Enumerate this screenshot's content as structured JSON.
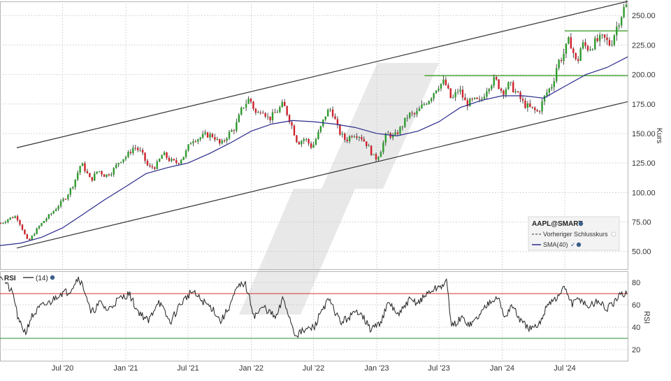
{
  "chart_data": [
    {
      "type": "candlestick",
      "panel": "price",
      "symbol": "AAPL@SMART",
      "ylabel": "Kurs",
      "ylim": [
        35,
        262
      ],
      "yticks": [
        50,
        75,
        100,
        125,
        150,
        175,
        200,
        225,
        250
      ],
      "ytick_labels": [
        "50.00",
        "75.00",
        "100.00",
        "125.00",
        "150.00",
        "175.00",
        "200.00",
        "225.00",
        "250.00"
      ],
      "xlim": [
        "2020-01-01",
        "2024-12-31"
      ],
      "xticks": [
        {
          "date": "2020-07-01",
          "label": "Jul '20"
        },
        {
          "date": "2021-01-01",
          "label": "Jan '21"
        },
        {
          "date": "2021-07-01",
          "label": "Jul '21"
        },
        {
          "date": "2022-01-01",
          "label": "Jan '22"
        },
        {
          "date": "2022-07-01",
          "label": "Jul '22"
        },
        {
          "date": "2023-01-01",
          "label": "Jan '23"
        },
        {
          "date": "2023-07-01",
          "label": "Jul '23"
        },
        {
          "date": "2024-01-01",
          "label": "Jan '24"
        },
        {
          "date": "2024-07-01",
          "label": "Jul '24"
        }
      ],
      "grid": true,
      "legend": {
        "title": "AAPL@SMART",
        "items": [
          {
            "label": "Vorheriger Schlusskurs",
            "style": "dashed",
            "color": "#333333"
          },
          {
            "label": "SMA(40)",
            "style": "solid",
            "color": "#2b2b8c"
          }
        ],
        "position": "bottom-right"
      },
      "close_series": [
        [
          "2020-01-06",
          74
        ],
        [
          "2020-01-27",
          78
        ],
        [
          "2020-02-17",
          80
        ],
        [
          "2020-03-02",
          72
        ],
        [
          "2020-03-16",
          62
        ],
        [
          "2020-03-23",
          58
        ],
        [
          "2020-04-06",
          64
        ],
        [
          "2020-04-20",
          70
        ],
        [
          "2020-05-11",
          77
        ],
        [
          "2020-06-01",
          83
        ],
        [
          "2020-06-22",
          90
        ],
        [
          "2020-07-13",
          97
        ],
        [
          "2020-08-03",
          108
        ],
        [
          "2020-08-24",
          125
        ],
        [
          "2020-09-07",
          118
        ],
        [
          "2020-09-21",
          110
        ],
        [
          "2020-10-12",
          119
        ],
        [
          "2020-11-02",
          114
        ],
        [
          "2020-11-23",
          118
        ],
        [
          "2020-12-14",
          127
        ],
        [
          "2021-01-04",
          131
        ],
        [
          "2021-01-25",
          139
        ],
        [
          "2021-02-15",
          134
        ],
        [
          "2021-03-08",
          121
        ],
        [
          "2021-03-29",
          122
        ],
        [
          "2021-04-19",
          133
        ],
        [
          "2021-05-10",
          127
        ],
        [
          "2021-05-31",
          125
        ],
        [
          "2021-06-21",
          132
        ],
        [
          "2021-07-12",
          145
        ],
        [
          "2021-08-02",
          146
        ],
        [
          "2021-08-23",
          149
        ],
        [
          "2021-09-13",
          148
        ],
        [
          "2021-10-04",
          140
        ],
        [
          "2021-10-25",
          149
        ],
        [
          "2021-11-15",
          155
        ],
        [
          "2021-12-06",
          172
        ],
        [
          "2021-12-27",
          180
        ],
        [
          "2022-01-17",
          165
        ],
        [
          "2022-01-31",
          172
        ],
        [
          "2022-02-21",
          162
        ],
        [
          "2022-03-14",
          168
        ],
        [
          "2022-04-04",
          175
        ],
        [
          "2022-04-25",
          160
        ],
        [
          "2022-05-16",
          142
        ],
        [
          "2022-06-06",
          146
        ],
        [
          "2022-06-27",
          138
        ],
        [
          "2022-07-18",
          152
        ],
        [
          "2022-08-08",
          168
        ],
        [
          "2022-08-22",
          171
        ],
        [
          "2022-09-12",
          152
        ],
        [
          "2022-10-03",
          144
        ],
        [
          "2022-10-24",
          150
        ],
        [
          "2022-11-14",
          148
        ],
        [
          "2022-12-05",
          140
        ],
        [
          "2022-12-27",
          128
        ],
        [
          "2023-01-09",
          133
        ],
        [
          "2023-01-30",
          150
        ],
        [
          "2023-02-20",
          147
        ],
        [
          "2023-03-13",
          155
        ],
        [
          "2023-04-03",
          166
        ],
        [
          "2023-04-24",
          166
        ],
        [
          "2023-05-15",
          174
        ],
        [
          "2023-06-05",
          180
        ],
        [
          "2023-06-26",
          190
        ],
        [
          "2023-07-17",
          194
        ],
        [
          "2023-08-07",
          178
        ],
        [
          "2023-08-28",
          188
        ],
        [
          "2023-09-18",
          175
        ],
        [
          "2023-10-09",
          178
        ],
        [
          "2023-10-30",
          177
        ],
        [
          "2023-11-20",
          190
        ],
        [
          "2023-12-11",
          196
        ],
        [
          "2024-01-02",
          185
        ],
        [
          "2024-01-22",
          192
        ],
        [
          "2024-02-12",
          184
        ],
        [
          "2024-03-04",
          175
        ],
        [
          "2024-03-25",
          171
        ],
        [
          "2024-04-15",
          168
        ],
        [
          "2024-05-06",
          183
        ],
        [
          "2024-05-27",
          192
        ],
        [
          "2024-06-10",
          210
        ],
        [
          "2024-06-24",
          215
        ],
        [
          "2024-07-15",
          230
        ],
        [
          "2024-08-05",
          208
        ],
        [
          "2024-08-19",
          226
        ],
        [
          "2024-09-09",
          222
        ],
        [
          "2024-09-30",
          228
        ],
        [
          "2024-10-21",
          231
        ],
        [
          "2024-11-11",
          225
        ],
        [
          "2024-12-02",
          243
        ],
        [
          "2024-12-23",
          258
        ]
      ],
      "sma40": [
        [
          "2020-01-01",
          55
        ],
        [
          "2020-03-01",
          57
        ],
        [
          "2020-05-01",
          62
        ],
        [
          "2020-07-01",
          70
        ],
        [
          "2020-09-01",
          82
        ],
        [
          "2020-11-01",
          94
        ],
        [
          "2021-01-01",
          105
        ],
        [
          "2021-03-01",
          116
        ],
        [
          "2021-05-01",
          121
        ],
        [
          "2021-07-01",
          125
        ],
        [
          "2021-09-01",
          133
        ],
        [
          "2021-11-01",
          142
        ],
        [
          "2022-01-01",
          152
        ],
        [
          "2022-03-01",
          158
        ],
        [
          "2022-05-01",
          161
        ],
        [
          "2022-07-01",
          160
        ],
        [
          "2022-09-01",
          158
        ],
        [
          "2022-11-01",
          155
        ],
        [
          "2023-01-01",
          150
        ],
        [
          "2023-03-01",
          148
        ],
        [
          "2023-05-01",
          152
        ],
        [
          "2023-07-01",
          160
        ],
        [
          "2023-09-01",
          172
        ],
        [
          "2023-11-01",
          178
        ],
        [
          "2024-01-01",
          182
        ],
        [
          "2024-03-01",
          182
        ],
        [
          "2024-05-01",
          180
        ],
        [
          "2024-07-01",
          190
        ],
        [
          "2024-09-01",
          200
        ],
        [
          "2024-11-01",
          206
        ],
        [
          "2024-12-31",
          215
        ]
      ],
      "trend_channel": {
        "upper": [
          [
            "2020-01-01",
            135
          ],
          [
            "2024-12-31",
            262
          ]
        ],
        "lower": [
          [
            "2020-01-01",
            50
          ],
          [
            "2024-12-31",
            177
          ]
        ]
      },
      "horizontal_levels": [
        {
          "value": 199,
          "from": "2023-05-20",
          "to": "2024-12-31",
          "color": "#3fa02a"
        },
        {
          "value": 237,
          "from": "2024-07-01",
          "to": "2024-12-31",
          "color": "#3fa02a"
        }
      ]
    },
    {
      "type": "line",
      "panel": "indicator",
      "title": "RSI",
      "ylabel": "RSI",
      "series": [
        {
          "name": "(14)",
          "color": "#222222"
        }
      ],
      "ylim": [
        10,
        90
      ],
      "yticks": [
        20,
        40,
        60,
        80
      ],
      "ytick_labels": [
        "20",
        "40",
        "60",
        "80"
      ],
      "overbought": 70,
      "oversold": 30,
      "points": [
        [
          "2020-01-01",
          88
        ],
        [
          "2020-02-10",
          68
        ],
        [
          "2020-02-24",
          45
        ],
        [
          "2020-03-16",
          35
        ],
        [
          "2020-03-30",
          48
        ],
        [
          "2020-04-27",
          58
        ],
        [
          "2020-05-25",
          62
        ],
        [
          "2020-06-22",
          70
        ],
        [
          "2020-07-20",
          72
        ],
        [
          "2020-08-17",
          85
        ],
        [
          "2020-09-07",
          70
        ],
        [
          "2020-09-21",
          52
        ],
        [
          "2020-10-19",
          62
        ],
        [
          "2020-11-09",
          55
        ],
        [
          "2020-12-07",
          64
        ],
        [
          "2021-01-11",
          70
        ],
        [
          "2021-02-01",
          56
        ],
        [
          "2021-03-08",
          45
        ],
        [
          "2021-04-05",
          64
        ],
        [
          "2021-05-10",
          44
        ],
        [
          "2021-06-07",
          60
        ],
        [
          "2021-07-12",
          72
        ],
        [
          "2021-08-09",
          64
        ],
        [
          "2021-09-13",
          56
        ],
        [
          "2021-10-04",
          45
        ],
        [
          "2021-10-25",
          56
        ],
        [
          "2021-11-22",
          75
        ],
        [
          "2021-12-13",
          80
        ],
        [
          "2022-01-10",
          50
        ],
        [
          "2022-02-07",
          58
        ],
        [
          "2022-03-14",
          48
        ],
        [
          "2022-04-04",
          66
        ],
        [
          "2022-05-09",
          33
        ],
        [
          "2022-06-13",
          38
        ],
        [
          "2022-07-04",
          40
        ],
        [
          "2022-07-25",
          56
        ],
        [
          "2022-08-15",
          64
        ],
        [
          "2022-09-19",
          44
        ],
        [
          "2022-10-17",
          50
        ],
        [
          "2022-11-14",
          55
        ],
        [
          "2022-12-12",
          38
        ],
        [
          "2023-01-09",
          43
        ],
        [
          "2023-02-06",
          62
        ],
        [
          "2023-03-06",
          50
        ],
        [
          "2023-04-03",
          64
        ],
        [
          "2023-05-01",
          62
        ],
        [
          "2023-06-05",
          72
        ],
        [
          "2023-07-03",
          76
        ],
        [
          "2023-07-24",
          80
        ],
        [
          "2023-08-07",
          40
        ],
        [
          "2023-09-04",
          48
        ],
        [
          "2023-10-02",
          42
        ],
        [
          "2023-10-30",
          52
        ],
        [
          "2023-11-27",
          64
        ],
        [
          "2023-12-18",
          68
        ],
        [
          "2024-01-08",
          48
        ],
        [
          "2024-01-29",
          60
        ],
        [
          "2024-02-26",
          44
        ],
        [
          "2024-03-25",
          38
        ],
        [
          "2024-04-15",
          40
        ],
        [
          "2024-05-13",
          62
        ],
        [
          "2024-06-10",
          66
        ],
        [
          "2024-07-01",
          76
        ],
        [
          "2024-07-22",
          60
        ],
        [
          "2024-08-12",
          66
        ],
        [
          "2024-09-09",
          58
        ],
        [
          "2024-10-07",
          64
        ],
        [
          "2024-10-28",
          56
        ],
        [
          "2024-11-18",
          60
        ],
        [
          "2024-12-09",
          68
        ],
        [
          "2024-12-31",
          72
        ]
      ]
    }
  ]
}
